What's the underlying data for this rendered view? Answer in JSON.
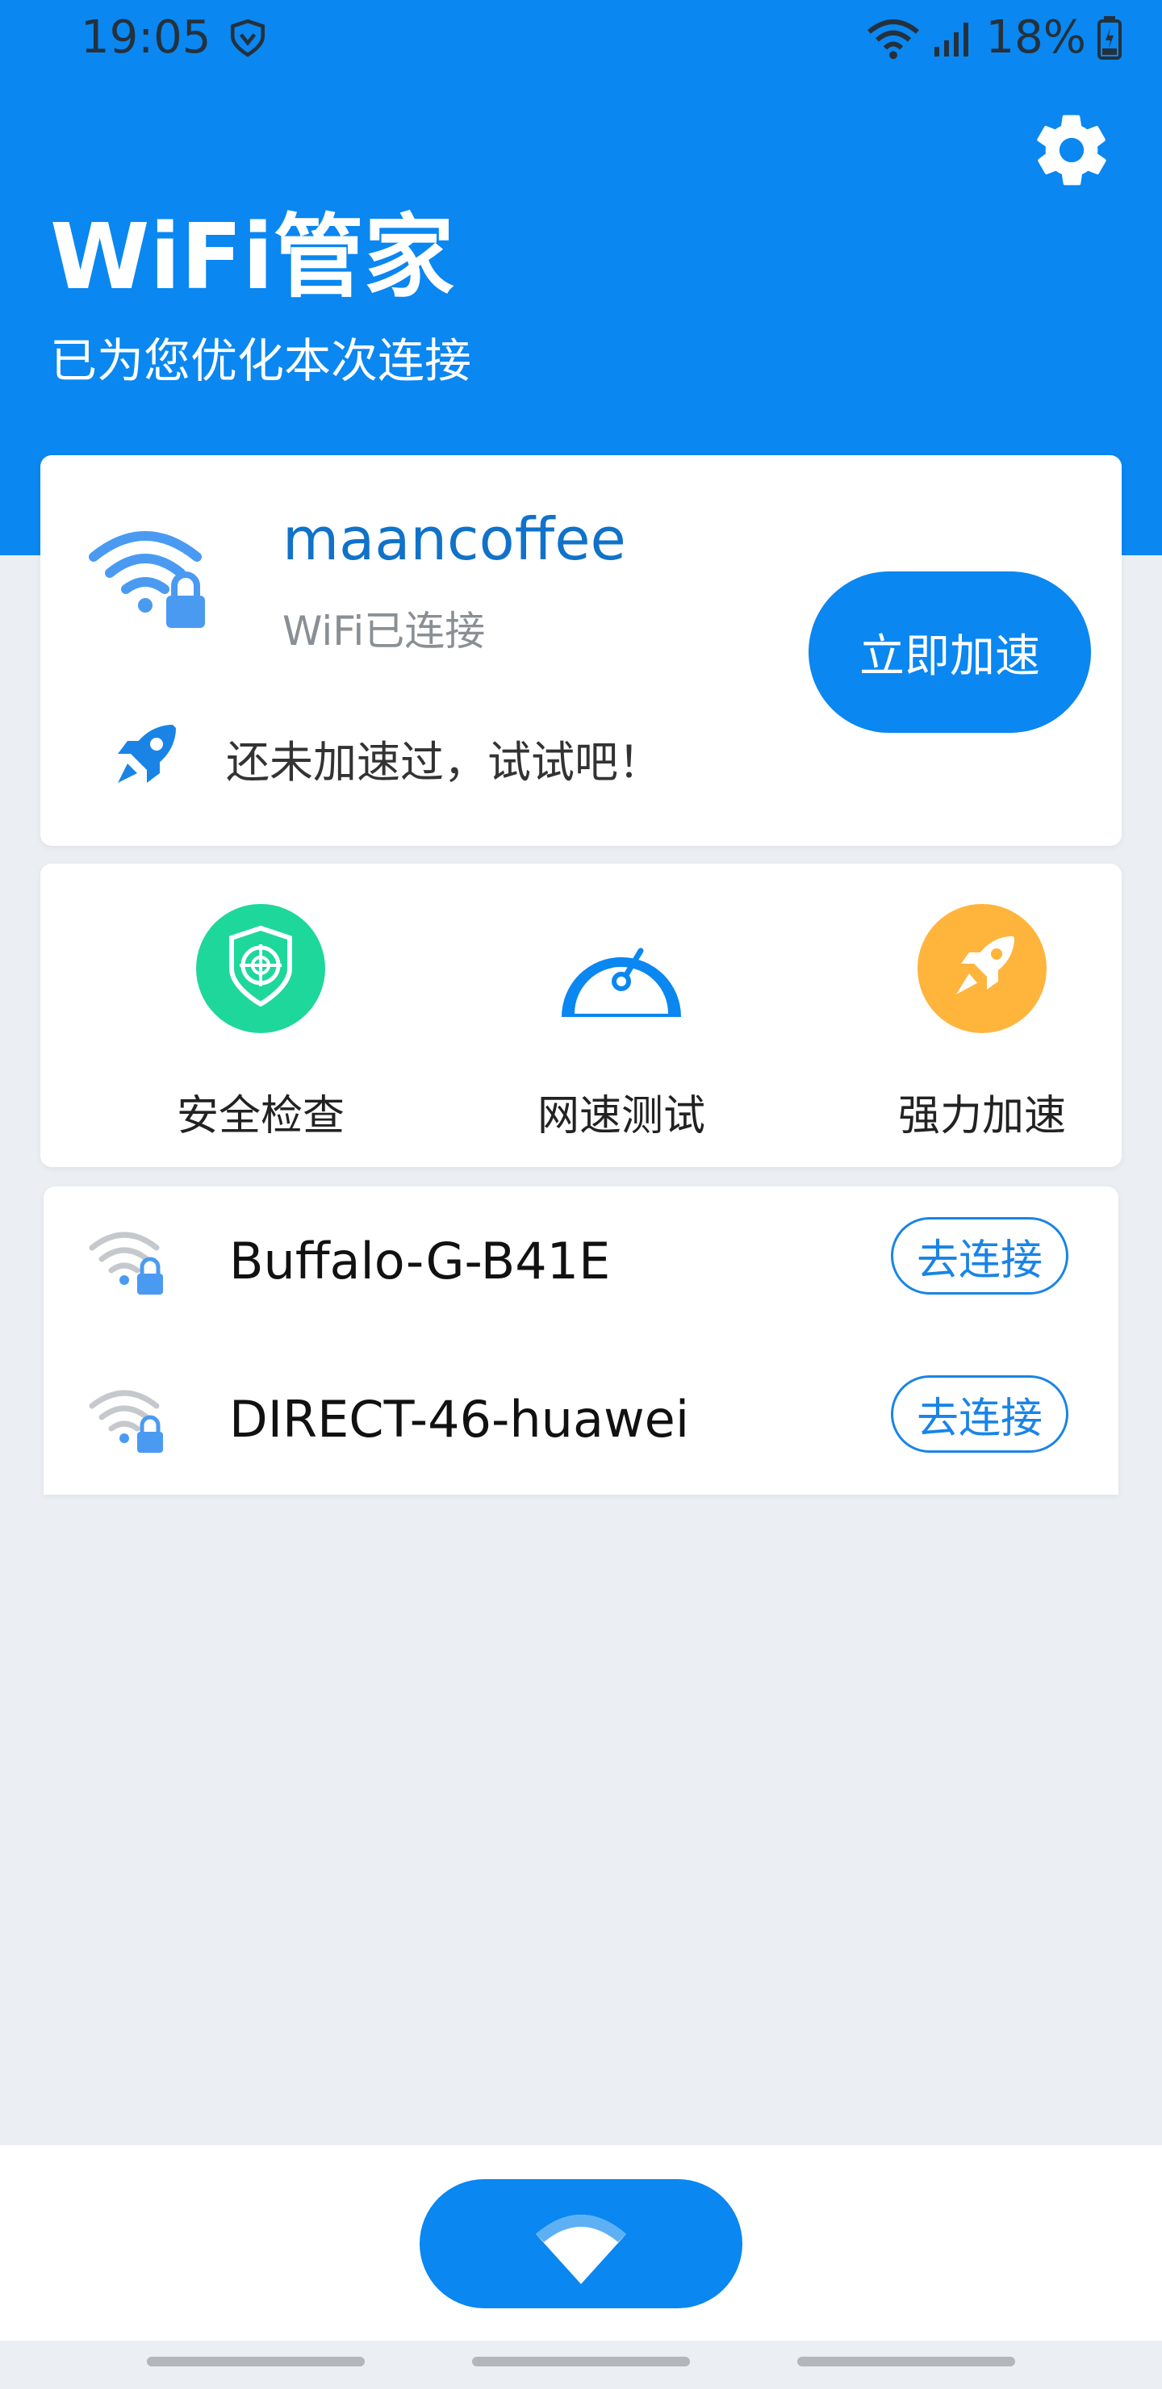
{
  "status": {
    "time": "19:05",
    "battery": "18%",
    "icons": [
      "shield-icon",
      "wifi-icon",
      "signal-icon",
      "battery-icon"
    ]
  },
  "header": {
    "title": "WiFi管家",
    "subtitle": "已为您优化本次连接",
    "settings_icon": "gear-icon"
  },
  "connection": {
    "ssid": "maancoffee",
    "status": "WiFi已连接",
    "accelerate_button": "立即加速",
    "hint": "还未加速过，试试吧！"
  },
  "tools": [
    {
      "label": "安全检查",
      "icon": "security-shield-icon",
      "color": "#1ed79b"
    },
    {
      "label": "网速测试",
      "icon": "speedometer-icon",
      "color": "#0a87f0"
    },
    {
      "label": "强力加速",
      "icon": "rocket-icon",
      "color": "#ffb43c"
    }
  ],
  "networks": [
    {
      "name": "Buffalo-G-B41E",
      "button": "去连接"
    },
    {
      "name": "DIRECT-46-huawei",
      "button": "去连接"
    }
  ],
  "colors": {
    "primary": "#0a87f0",
    "background": "#ebeff3",
    "ssid_text": "#1072c9"
  }
}
